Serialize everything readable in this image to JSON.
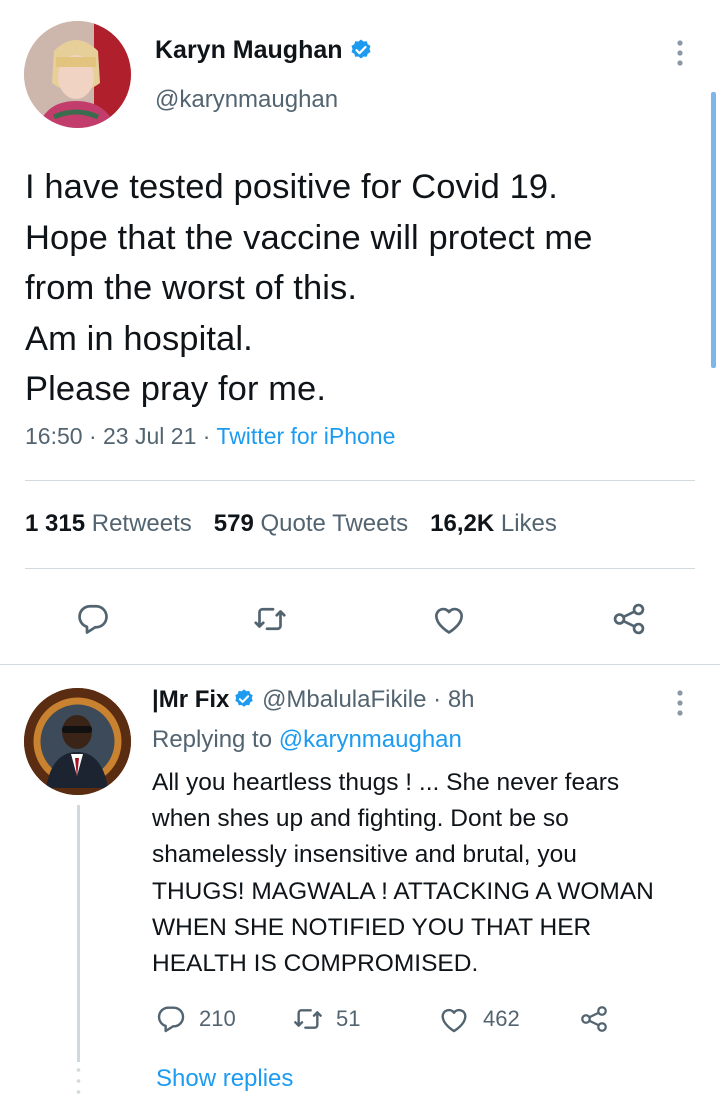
{
  "tweet": {
    "author": {
      "name": "Karyn Maughan",
      "handle": "@karynmaughan",
      "verified": true,
      "avatar_icon": "profile-photo"
    },
    "text": "I have tested positive for Covid 19.\nHope that the vaccine will protect me\nfrom the worst of this.\nAm in hospital.\nPlease pray for me.",
    "time": "16:50",
    "separator": "·",
    "date": "23 Jul 21",
    "source": "Twitter for iPhone",
    "stats": {
      "retweets_count": "1 315",
      "retweets_label": "Retweets",
      "quotes_count": "579",
      "quotes_label": "Quote Tweets",
      "likes_count": "16,2K",
      "likes_label": "Likes"
    },
    "actions": [
      "reply-icon",
      "retweet-icon",
      "like-icon",
      "share-icon"
    ]
  },
  "reply": {
    "author": {
      "name": "|Mr Fix",
      "handle": "@MbalulaFikile",
      "verified": true,
      "avatar_icon": "profile-photo"
    },
    "separator": "·",
    "age": "8h",
    "replying_prefix": "Replying to",
    "replying_to": "@karynmaughan",
    "text": "All you heartless thugs ! ... She never fears\nwhen shes up and fighting. Dont be so\nshamelessly  insensitive and brutal, you\nTHUGS! MAGWALA ! ATTACKING A WOMAN\nWHEN SHE NOTIFIED YOU THAT HER\nHEALTH IS COMPROMISED.",
    "counts": {
      "replies": "210",
      "retweets": "51",
      "likes": "462"
    },
    "show_replies": "Show replies"
  },
  "colors": {
    "text": "#0f1419",
    "secondary": "#536471",
    "accent": "#1d9bf0",
    "divider": "#cfd9de"
  }
}
